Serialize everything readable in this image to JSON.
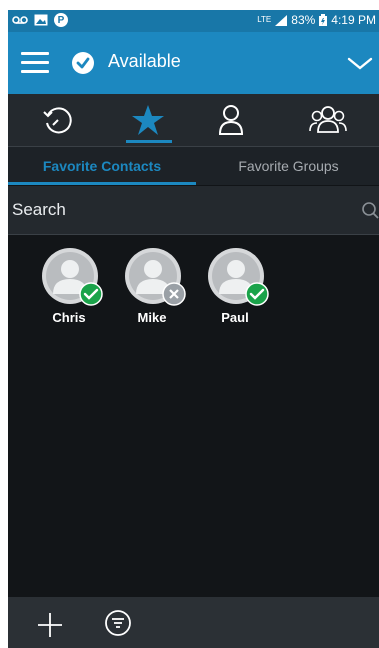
{
  "status_bar": {
    "network": "LTE",
    "battery": "83%",
    "time": "4:19 PM",
    "p_badge": "P"
  },
  "header": {
    "presence_label": "Available",
    "accent": "#1c88c0"
  },
  "nav_tabs": [
    {
      "icon": "history-icon"
    },
    {
      "icon": "star-icon",
      "active": true
    },
    {
      "icon": "person-icon"
    },
    {
      "icon": "group-icon"
    }
  ],
  "subtabs": {
    "favorite_contacts": "Favorite Contacts",
    "favorite_groups": "Favorite Groups"
  },
  "search": {
    "placeholder": "Search"
  },
  "contacts": [
    {
      "name": "Chris",
      "status": "available"
    },
    {
      "name": "Mike",
      "status": "offline"
    },
    {
      "name": "Paul",
      "status": "available"
    }
  ],
  "colors": {
    "available": "#1aa34a",
    "offline": "#9aa0a6",
    "active_tab": "#1c88c0"
  }
}
